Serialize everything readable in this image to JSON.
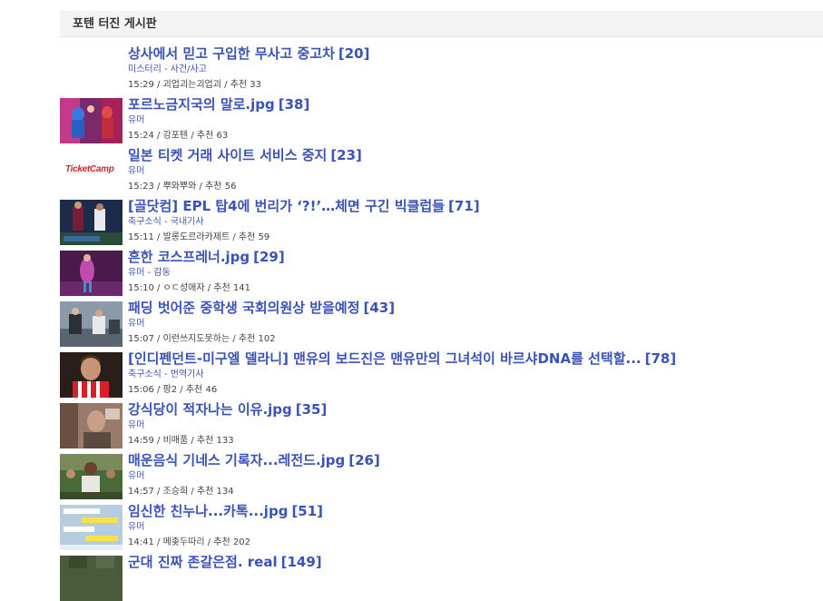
{
  "board": {
    "title": "포텐 터진 게시판"
  },
  "posts": [
    {
      "title": "상사에서 믿고 구입한 무사고 중고차",
      "count": "[20]",
      "category": "미스터리 - 사건/사고",
      "time": "15:29",
      "author": "괴업괴는괴업괴",
      "likes_label": "추천",
      "likes": "33",
      "thumb": "none"
    },
    {
      "title": "포르노금지국의 말로.jpg",
      "count": "[38]",
      "category": "유머",
      "time": "15:24",
      "author": "강포텐",
      "likes_label": "추천",
      "likes": "63",
      "thumb": "dance-photo"
    },
    {
      "title": "일본 티켓 거래 사이트 서비스 중지",
      "count": "[23]",
      "category": "유머",
      "time": "15:23",
      "author": "뿌와뿌와",
      "likes_label": "추천",
      "likes": "56",
      "thumb": "ticketcamp-logo",
      "thumb_text": "TicketCamp"
    },
    {
      "title": "[골닷컴] EPL 탑4에 번리가 ‘?!’…체면 구긴 빅클럽들",
      "count": "[71]",
      "category": "축구소식 - 국내기사",
      "time": "15:11",
      "author": "발롱도르라카제트",
      "likes_label": "추천",
      "likes": "59",
      "thumb": "soccer-photo"
    },
    {
      "title": "흔한 코스프레너.jpg",
      "count": "[29]",
      "category": "유머 - 감동",
      "time": "15:10",
      "author": "ㅇㄷ성애자",
      "likes_label": "추천",
      "likes": "141",
      "thumb": "cosplay-photo"
    },
    {
      "title": "패딩 벗어준 중학생 국회의원상 받을예정",
      "count": "[43]",
      "category": "유머",
      "time": "15:07",
      "author": "이런쓰지도못하는",
      "likes_label": "추천",
      "likes": "102",
      "thumb": "news-photo"
    },
    {
      "title": "[인디펜던트-미구엘 델라니] 맨유의 보드진은 맨유만의 그녀석이 바르샤DNA를 선택할...",
      "count": "[78]",
      "category": "축구소식 - 번역기사",
      "time": "15:06",
      "author": "팡2",
      "likes_label": "추천",
      "likes": "46",
      "thumb": "player-photo"
    },
    {
      "title": "강식당이 적자나는 이유.jpg",
      "count": "[35]",
      "category": "유머",
      "time": "14:59",
      "author": "비매품",
      "likes_label": "추천",
      "likes": "133",
      "thumb": "tv-photo"
    },
    {
      "title": "매운음식 기네스 기록자...레전드.jpg",
      "count": "[26]",
      "category": "유머",
      "time": "14:57",
      "author": "조승희",
      "likes_label": "추천",
      "likes": "134",
      "thumb": "crowd-photo"
    },
    {
      "title": "임신한 친누나...카톡...jpg",
      "count": "[51]",
      "category": "유머",
      "time": "14:41",
      "author": "메좆두따리",
      "likes_label": "추천",
      "likes": "202",
      "thumb": "chat-screenshot"
    },
    {
      "title": "군대 진짜 존갈은점. real",
      "count": "[149]",
      "category": "",
      "time": "",
      "author": "",
      "likes_label": "",
      "likes": "",
      "thumb": "army-photo"
    }
  ]
}
